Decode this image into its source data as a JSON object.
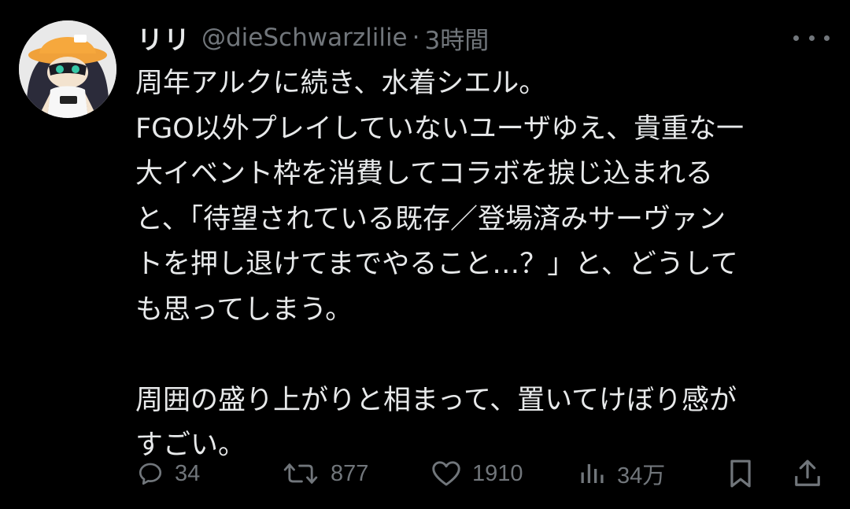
{
  "author": {
    "display_name": "リリ",
    "handle": "@dieSchwarzlilie",
    "separator": "·",
    "timestamp": "3時間"
  },
  "post": {
    "lines": [
      "周年アルクに続き、水着シエル。",
      "FGO以外プレイしていないユーザゆえ、貴重な一",
      "大イベント枠を消費してコラボを捩じ込まれる",
      "と、「待望されている既存／登場済みサーヴァン",
      "トを押し退けてまでやること…？」と、どうして",
      "も思ってしまう。",
      "",
      "周囲の盛り上がりと相まって、置いてけぼり感が",
      "すごい。"
    ]
  },
  "actions": {
    "reply": {
      "icon": "reply-icon",
      "count": "34"
    },
    "repost": {
      "icon": "repost-icon",
      "count": "877"
    },
    "like": {
      "icon": "heart-icon",
      "count": "1910"
    },
    "views": {
      "icon": "views-icon",
      "count": "34万"
    },
    "bookmark": {
      "icon": "bookmark-icon"
    },
    "share": {
      "icon": "share-icon"
    }
  },
  "menu": {
    "icon": "more-icon"
  },
  "colors": {
    "background": "#000000",
    "text": "#e7e9ea",
    "secondary": "#71767b"
  }
}
